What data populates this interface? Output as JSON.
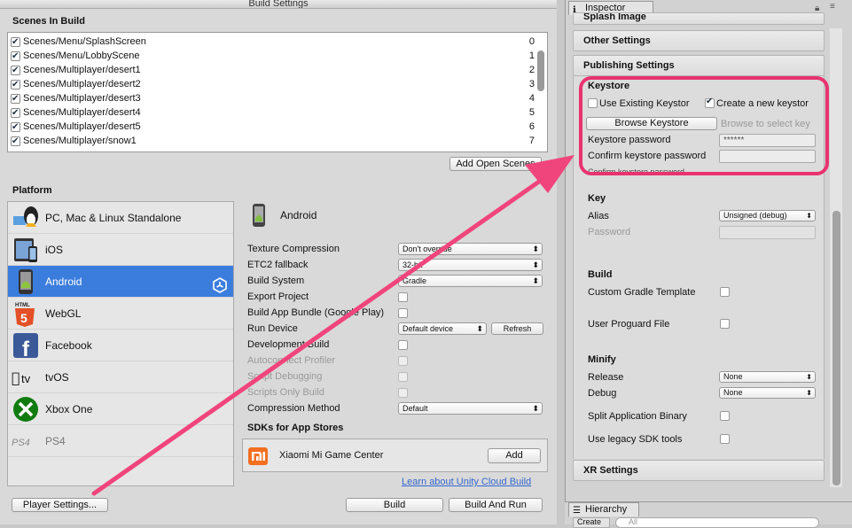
{
  "build_window": {
    "title": "Build Settings",
    "scenes_header": "Scenes In Build",
    "scenes": [
      {
        "name": "Scenes/Menu/SplashScreen",
        "index": "0",
        "checked": true
      },
      {
        "name": "Scenes/Menu/LobbyScene",
        "index": "1",
        "checked": true
      },
      {
        "name": "Scenes/Multiplayer/desert1",
        "index": "2",
        "checked": true
      },
      {
        "name": "Scenes/Multiplayer/desert2",
        "index": "3",
        "checked": true
      },
      {
        "name": "Scenes/Multiplayer/desert3",
        "index": "4",
        "checked": true
      },
      {
        "name": "Scenes/Multiplayer/desert4",
        "index": "5",
        "checked": true
      },
      {
        "name": "Scenes/Multiplayer/desert5",
        "index": "6",
        "checked": true
      },
      {
        "name": "Scenes/Multiplayer/snow1",
        "index": "7",
        "checked": true
      }
    ],
    "add_open_scenes": "Add Open Scenes",
    "platform_header": "Platform",
    "platforms": [
      {
        "label": "PC, Mac & Linux Standalone",
        "icon": "pc-mac-linux-icon"
      },
      {
        "label": "iOS",
        "icon": "ios-icon"
      },
      {
        "label": "Android",
        "icon": "android-icon",
        "selected": true
      },
      {
        "label": "WebGL",
        "icon": "html5-icon"
      },
      {
        "label": "Facebook",
        "icon": "facebook-icon"
      },
      {
        "label": "tvOS",
        "icon": "apple-tv-icon"
      },
      {
        "label": "Xbox One",
        "icon": "xbox-icon"
      },
      {
        "label": "PS4",
        "icon": "ps4-icon"
      }
    ],
    "selected_platform_title": "Android",
    "options": {
      "texture_compression": {
        "label": "Texture Compression",
        "value": "Don't override"
      },
      "etc2_fallback": {
        "label": "ETC2 fallback",
        "value": "32-bit"
      },
      "build_system": {
        "label": "Build System",
        "value": "Gradle"
      },
      "export_project": {
        "label": "Export Project"
      },
      "build_app_bundle": {
        "label": "Build App Bundle (Google Play)"
      },
      "run_device": {
        "label": "Run Device",
        "value": "Default device",
        "refresh": "Refresh"
      },
      "development_build": {
        "label": "Development Build"
      },
      "autoconnect_profiler": {
        "label": "Autoconnect Profiler"
      },
      "script_debugging": {
        "label": "Script Debugging"
      },
      "scripts_only_build": {
        "label": "Scripts Only Build"
      },
      "compression_method": {
        "label": "Compression Method",
        "value": "Default"
      }
    },
    "sdks_header": "SDKs for App Stores",
    "sdk_item": {
      "name": "Xiaomi Mi Game Center",
      "button": "Add"
    },
    "cloud_build_link": "Learn about Unity Cloud Build",
    "player_settings": "Player Settings...",
    "build": "Build",
    "build_and_run": "Build And Run"
  },
  "inspector": {
    "tab_label": "Inspector",
    "splash_image": "Splash Image",
    "other_settings": "Other Settings",
    "publishing_settings": "Publishing Settings",
    "keystore_header": "Keystore",
    "use_existing": "Use Existing Keystor",
    "create_new": "Create a new keystor",
    "browse_keystore": "Browse Keystore",
    "browse_hint": "Browse to select key",
    "keystore_password_label": "Keystore password",
    "keystore_password_value": "******",
    "confirm_password_label": "Confirm keystore password",
    "confirm_password_overflow": "Confirm keystore password",
    "key_header": "Key",
    "alias_label": "Alias",
    "alias_value": "Unsigned (debug)",
    "password_label": "Password",
    "build_header": "Build",
    "custom_gradle": "Custom Gradle Template",
    "user_proguard": "User Proguard File",
    "minify_header": "Minify",
    "release_label": "Release",
    "release_value": "None",
    "debug_label": "Debug",
    "debug_value": "None",
    "split_binary": "Split Application Binary",
    "legacy_sdk": "Use legacy SDK tools",
    "xr_settings": "XR Settings"
  },
  "hierarchy": {
    "tab_label": "Hierarchy",
    "create": "Create",
    "search_placeholder": "All"
  },
  "colors": {
    "highlight": "#e8336f",
    "selection": "#3b7ddd",
    "link": "#3366cc"
  }
}
